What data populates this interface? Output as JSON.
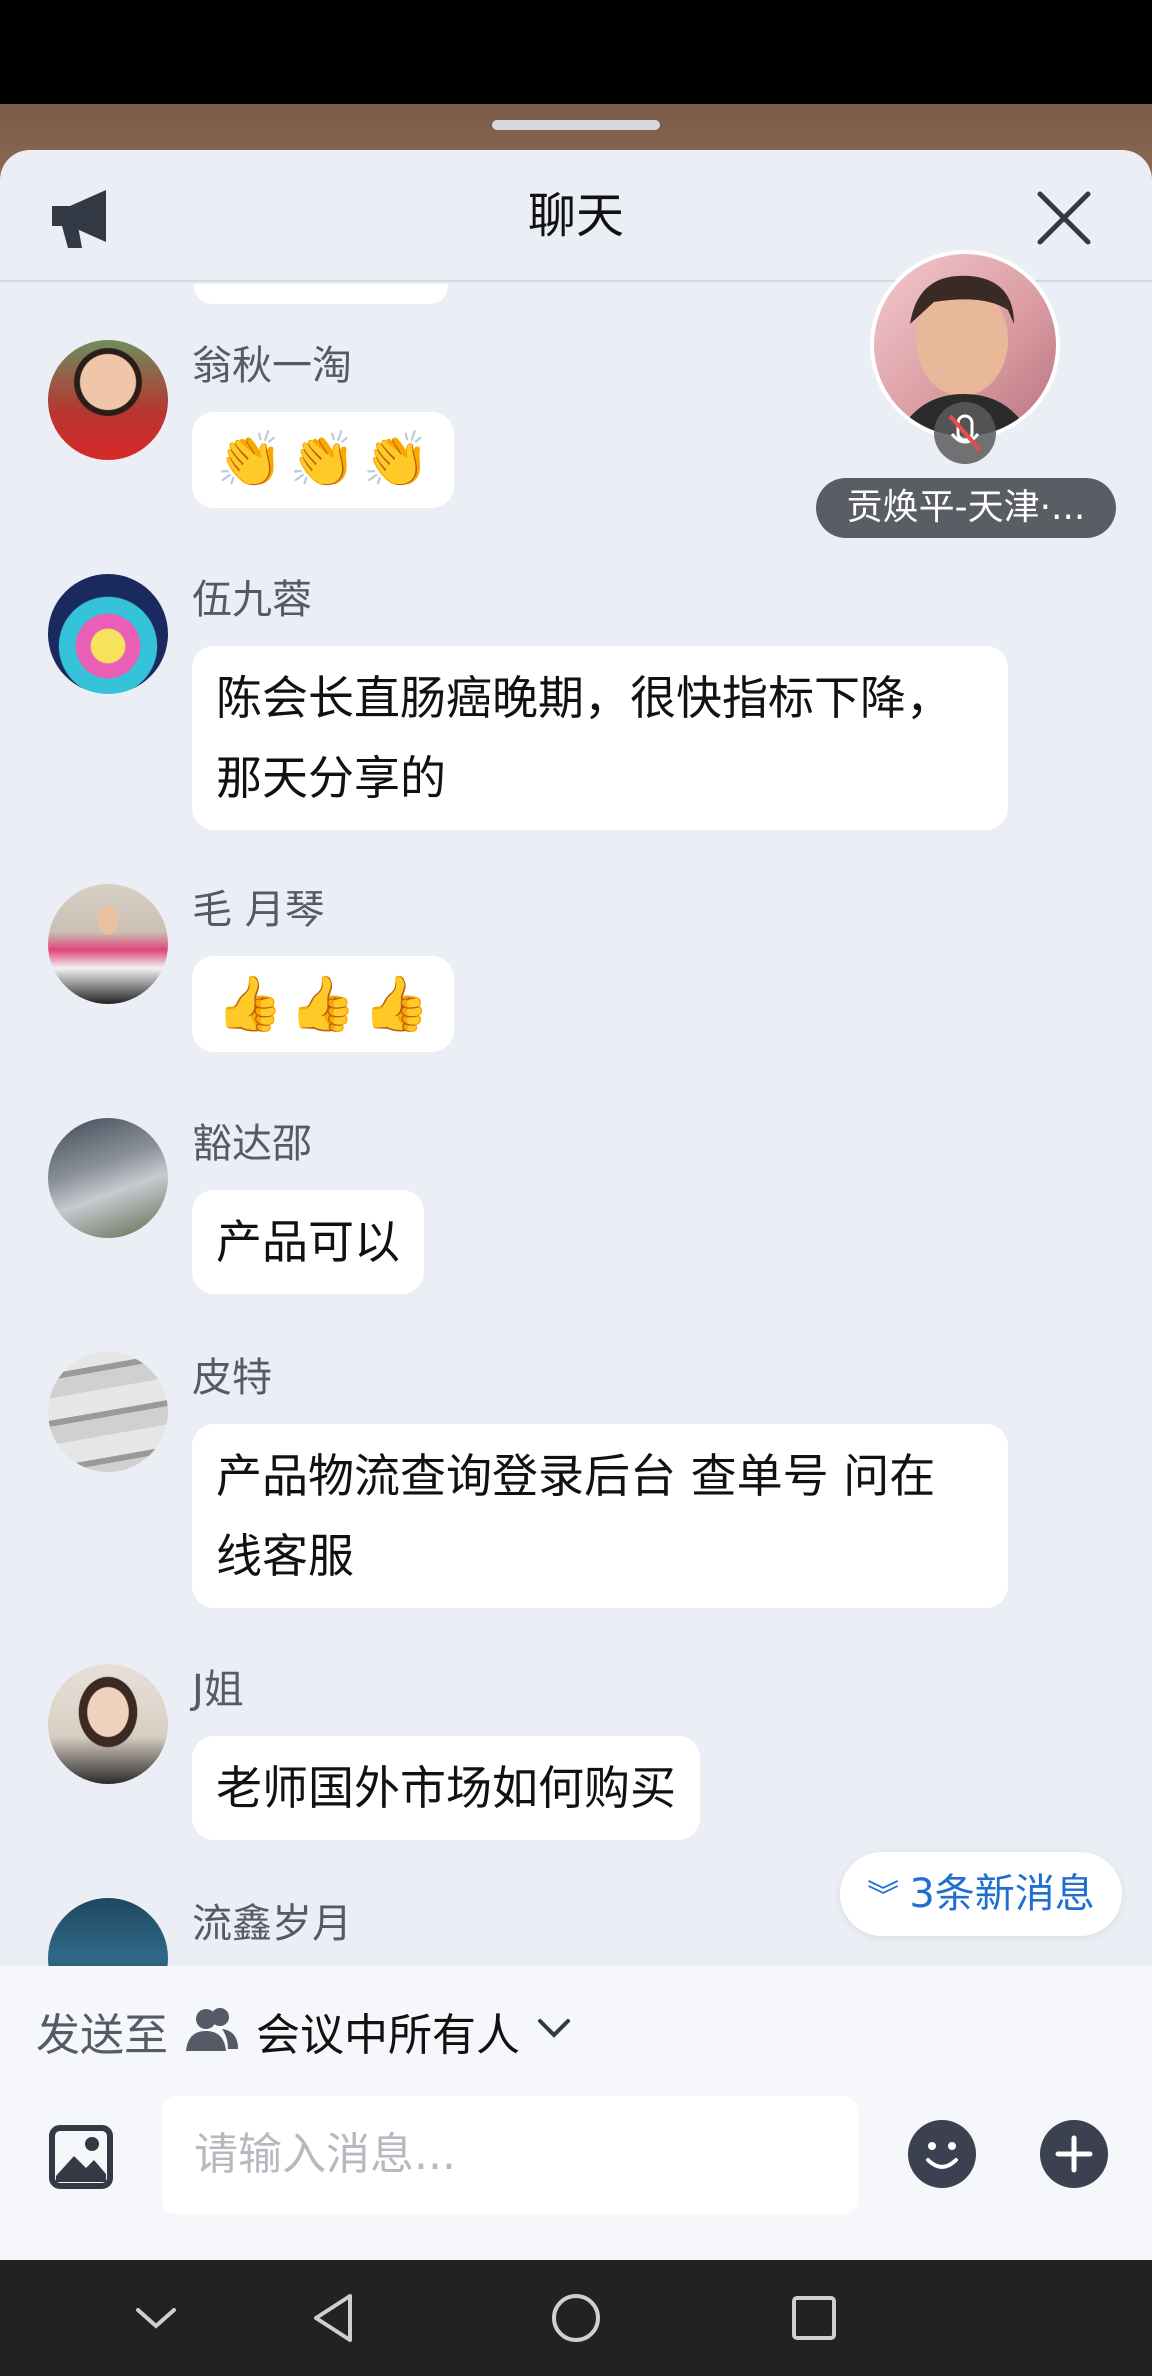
{
  "header": {
    "title": "聊天"
  },
  "floating_video": {
    "name": "贡焕平-天津·..."
  },
  "messages": [
    {
      "sender": "翁秋一淘",
      "emoji": [
        "👏",
        "👏",
        "👏"
      ]
    },
    {
      "sender": "伍九蓉",
      "text_lines": [
        "陈会长直肠癌晚期，很快指标下降，",
        "那天分享的"
      ]
    },
    {
      "sender": "毛 月琴",
      "emoji": [
        "👍",
        "👍",
        "👍"
      ]
    },
    {
      "sender": "豁达邵",
      "text_lines": [
        "产品可以"
      ]
    },
    {
      "sender": "皮特",
      "text_lines": [
        "产品物流查询登录后台 查单号 问在",
        "线客服"
      ]
    },
    {
      "sender": "J姐",
      "text_lines": [
        "老师国外市场如何购买"
      ]
    },
    {
      "sender": "流鑫岁月"
    }
  ],
  "new_messages": "3条新消息",
  "compose": {
    "send_to_label": "发送至",
    "send_to_value": "会议中所有人",
    "placeholder": "请输入消息..."
  },
  "colors": {
    "accent": "#1f6fd1",
    "sheet_bg": "#eceef5",
    "bubble": "#ffffff"
  }
}
